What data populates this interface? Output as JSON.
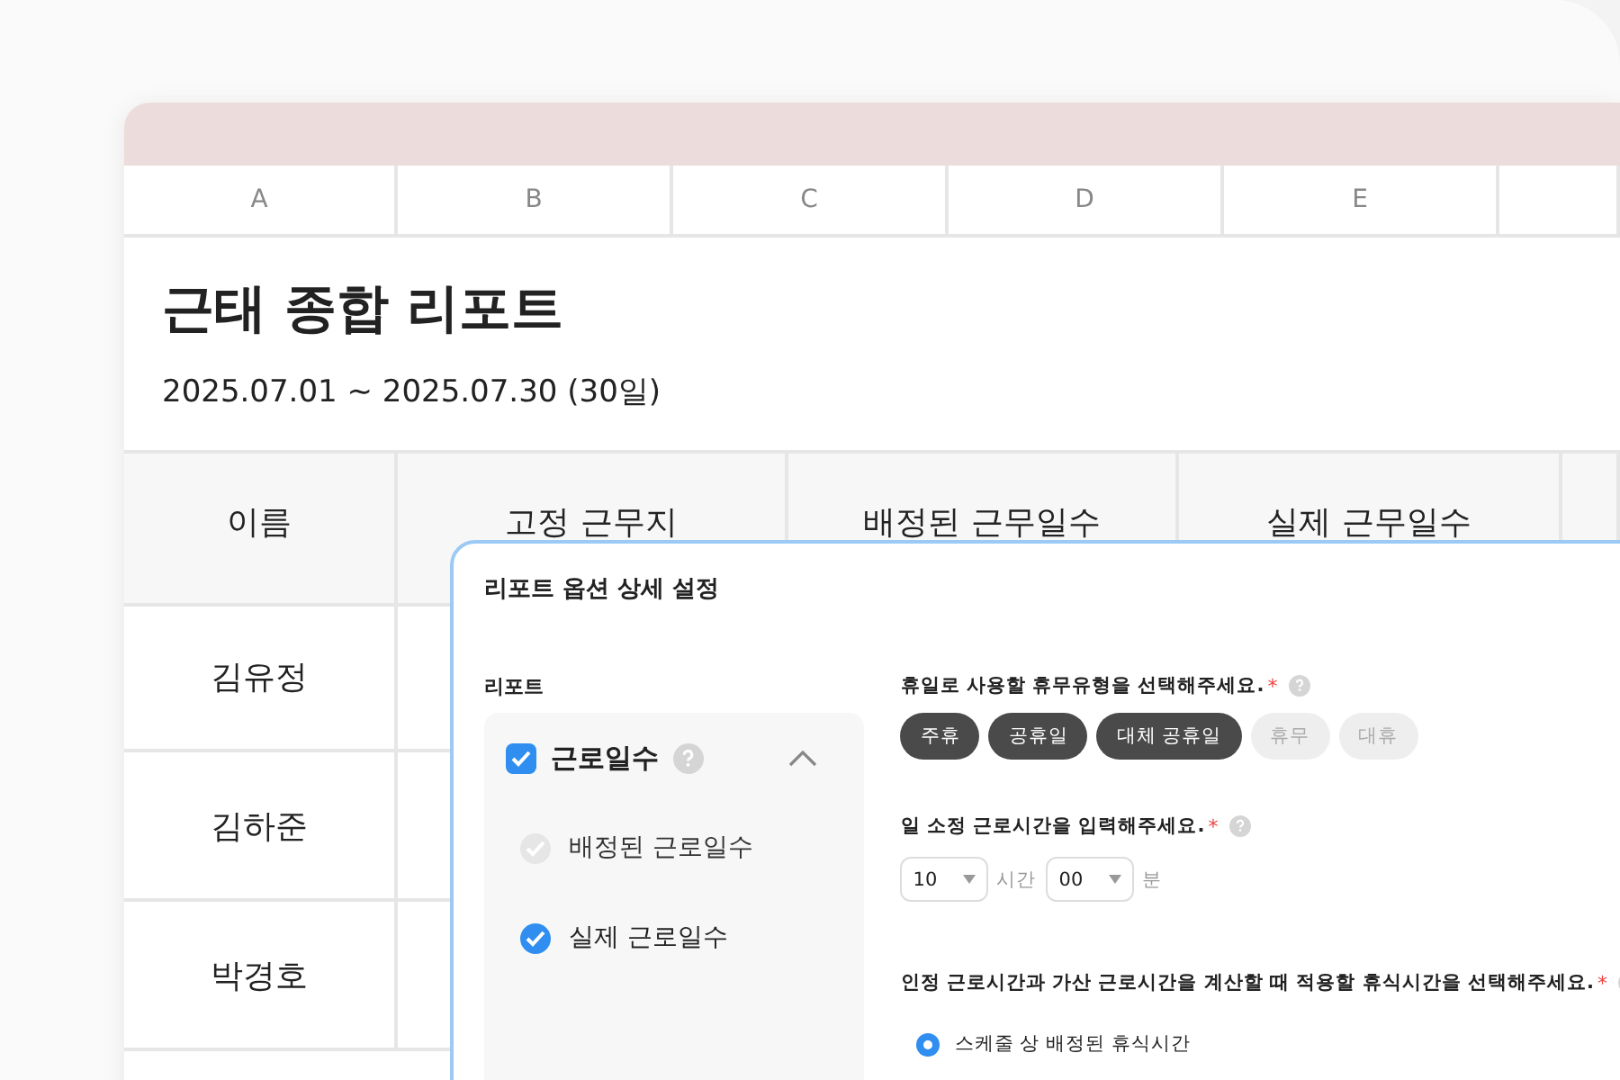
{
  "sheet": {
    "column_letters": [
      "A",
      "B",
      "C",
      "D",
      "E"
    ],
    "title": "근태 종합 리포트",
    "period": "2025.07.01 ~ 2025.07.30 (30일)",
    "header": [
      "이름",
      "고정 근무지",
      "배정된 근무일수",
      "실제 근무일수"
    ],
    "rows": [
      "김유정",
      "김하준",
      "박경호"
    ]
  },
  "dialog": {
    "title": "리포트 옵션 상세 설정",
    "left_label": "리포트",
    "required_mark": "*",
    "group": {
      "label": "근로일수",
      "checked": true,
      "expanded": true,
      "items": [
        {
          "label": "배정된 근로일수",
          "checked": true,
          "disabled": true
        },
        {
          "label": "실제 근로일수",
          "checked": true,
          "disabled": false
        }
      ]
    },
    "sections": [
      {
        "kind": "chips",
        "question": "휴일로 사용할 휴무유형을 선택해주세요.",
        "required": true,
        "options": [
          {
            "label": "주휴",
            "selected": true
          },
          {
            "label": "공휴일",
            "selected": true
          },
          {
            "label": "대체 공휴일",
            "selected": true
          },
          {
            "label": "휴무",
            "selected": false
          },
          {
            "label": "대휴",
            "selected": false
          }
        ]
      },
      {
        "kind": "time",
        "question": "일 소정 근로시간을 입력해주세요.",
        "required": true,
        "fields": [
          {
            "value": "10",
            "unit": "시간"
          },
          {
            "value": "00",
            "unit": "분"
          }
        ]
      },
      {
        "kind": "radio",
        "question": "인정 근로시간과 가산 근로시간을 계산할 때 적용할 휴식시간을 선택해주세요.",
        "required": true,
        "options": [
          {
            "label": "스케줄 상 배정된 휴식시간",
            "selected": true
          }
        ]
      }
    ]
  }
}
